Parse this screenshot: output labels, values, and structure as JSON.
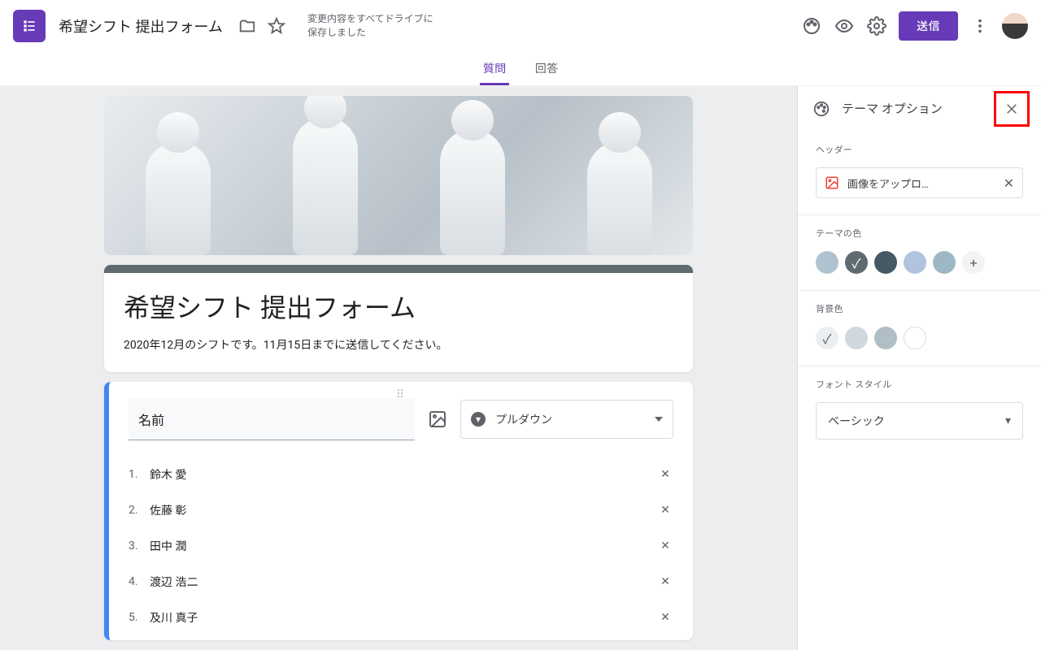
{
  "header": {
    "form_title": "希望シフト 提出フォーム",
    "save_status": "変更内容をすべてドライブに保存しました",
    "send": "送信"
  },
  "tabs": {
    "questions": "質問",
    "responses": "回答"
  },
  "form": {
    "title": "希望シフト 提出フォーム",
    "description": "2020年12月のシフトです。11月15日までに送信してください。"
  },
  "question": {
    "title": "名前",
    "type_label": "プルダウン",
    "options": [
      {
        "n": "1.",
        "label": "鈴木 愛"
      },
      {
        "n": "2.",
        "label": "佐藤 彰"
      },
      {
        "n": "3.",
        "label": "田中 潤"
      },
      {
        "n": "4.",
        "label": "渡辺 浩二"
      },
      {
        "n": "5.",
        "label": "及川 真子"
      }
    ]
  },
  "sidepanel": {
    "title": "テーマ オプション",
    "header_section": "ヘッダー",
    "upload_label": "画像をアップロ…",
    "theme_color_label": "テーマの色",
    "theme_colors": [
      {
        "hex": "#aec3cf",
        "selected": false
      },
      {
        "hex": "#5f6b70",
        "selected": true
      },
      {
        "hex": "#455a64",
        "selected": false
      },
      {
        "hex": "#b0c4de",
        "selected": false
      },
      {
        "hex": "#9db8c4",
        "selected": false
      }
    ],
    "bg_label": "背景色",
    "bg_colors": [
      {
        "hex": "#eceff1",
        "selected": true
      },
      {
        "hex": "#cfd8dc",
        "selected": false
      },
      {
        "hex": "#b0bec5",
        "selected": false
      },
      {
        "hex": "#ffffff",
        "selected": false
      }
    ],
    "font_label": "フォント スタイル",
    "font_value": "ベーシック"
  }
}
